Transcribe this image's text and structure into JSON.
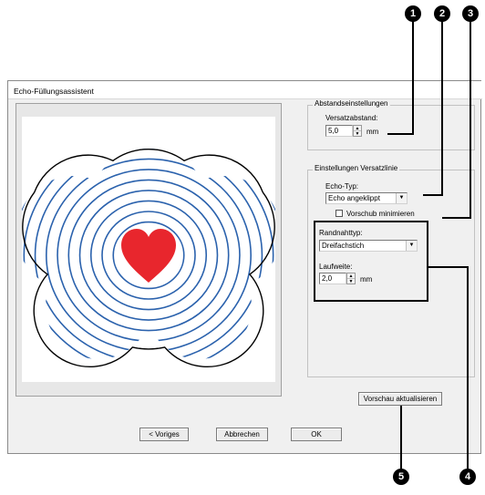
{
  "dialog": {
    "title": "Echo-Füllungsassistent"
  },
  "spacing_group": {
    "label": "Abstandseinstellungen",
    "offset_label": "Versatzabstand:",
    "offset_value": "5,0",
    "offset_unit": "mm"
  },
  "offset_line_group": {
    "label": "Einstellungen Versatzlinie",
    "echo_type_label": "Echo-Typ:",
    "echo_type_value": "Echo angeklippt",
    "minimize_feed_label": "Vorschub minimieren",
    "minimize_feed_checked": false,
    "edge_stitch_label": "Randnahttyp:",
    "edge_stitch_value": "Dreifachstich",
    "run_pitch_label": "Laufweite:",
    "run_pitch_value": "2,0",
    "run_pitch_unit": "mm"
  },
  "buttons": {
    "refresh_preview": "Vorschau aktualisieren",
    "back": "< Voriges",
    "cancel": "Abbrechen",
    "ok": "OK"
  },
  "preview": {
    "echo_line_color": "#2b62ad",
    "heart_color": "#e8262d",
    "outline_color": "#000000"
  },
  "callouts": [
    "1",
    "2",
    "3",
    "4",
    "5"
  ]
}
